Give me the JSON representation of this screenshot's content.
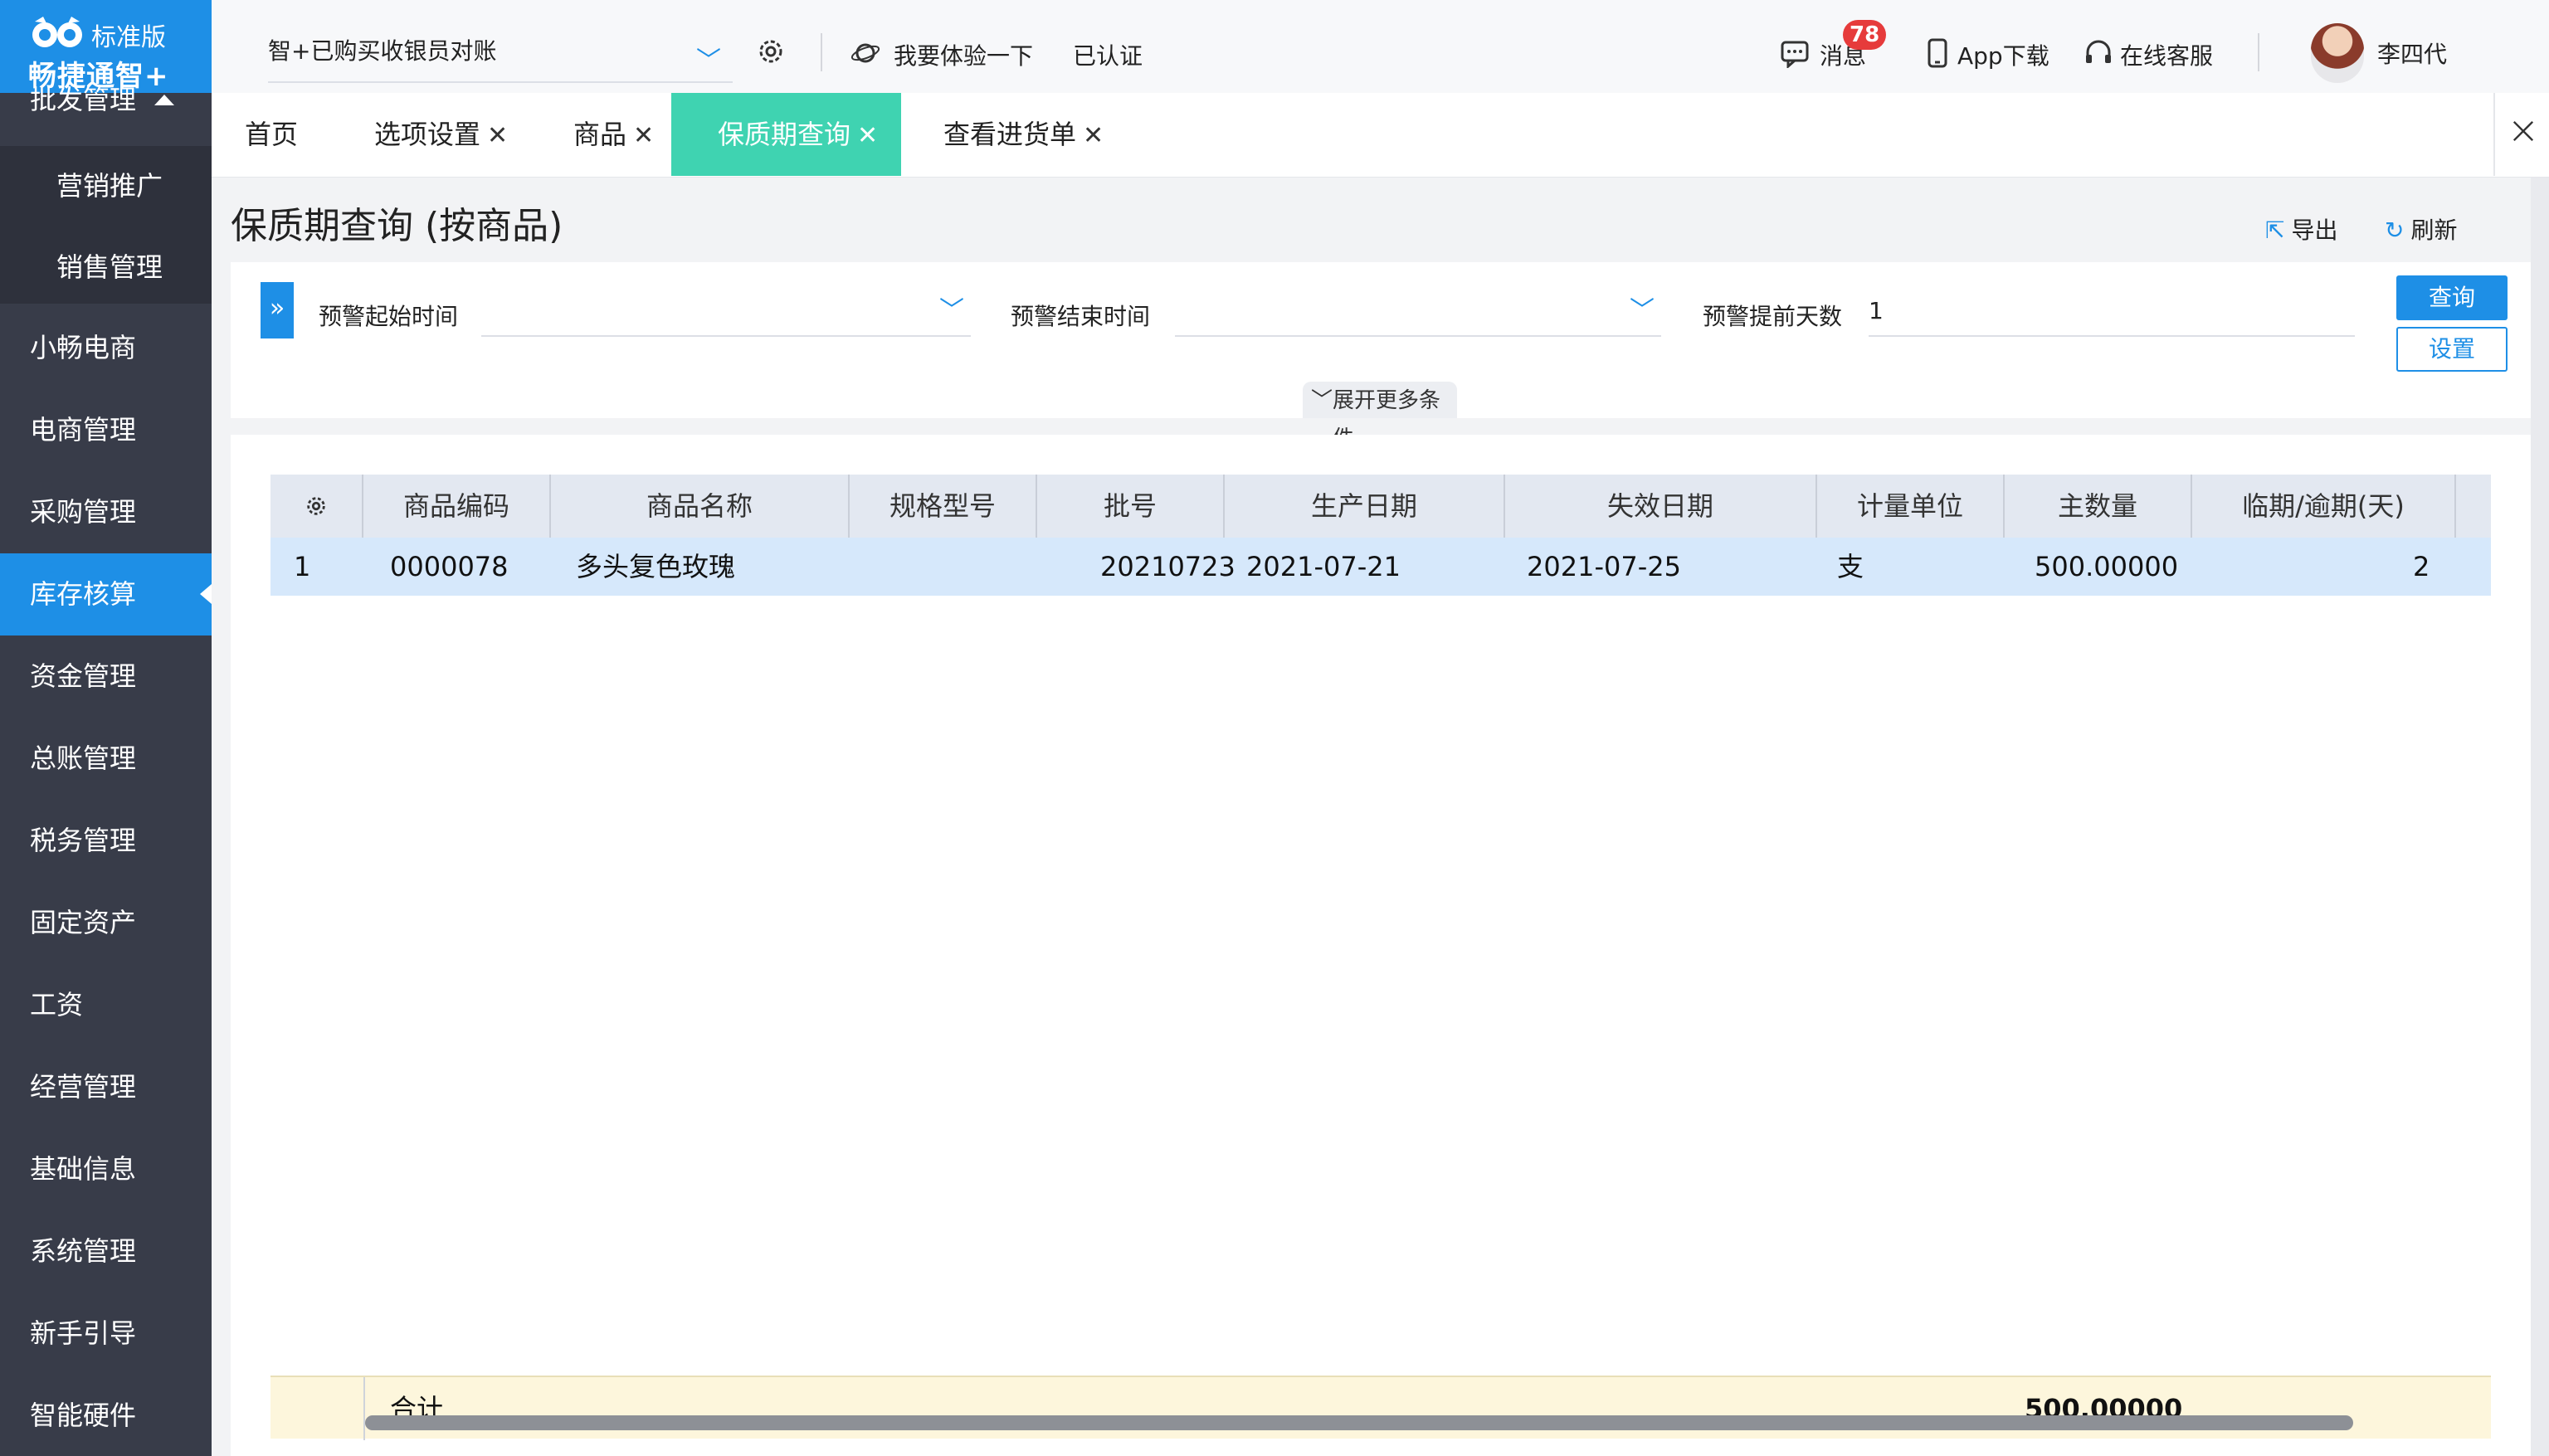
{
  "app": {
    "edition": "标准版",
    "brand": "畅捷通智+"
  },
  "sidebar": {
    "group_header": "批发管理",
    "subitems": [
      {
        "label": "营销推广"
      },
      {
        "label": "销售管理"
      }
    ],
    "items": [
      {
        "label": "小畅电商"
      },
      {
        "label": "电商管理"
      },
      {
        "label": "采购管理"
      },
      {
        "label": "库存核算",
        "active": true
      },
      {
        "label": "资金管理"
      },
      {
        "label": "总账管理"
      },
      {
        "label": "税务管理"
      },
      {
        "label": "固定资产"
      },
      {
        "label": "工资"
      },
      {
        "label": "经营管理"
      },
      {
        "label": "基础信息"
      },
      {
        "label": "系统管理"
      },
      {
        "label": "新手引导"
      },
      {
        "label": "智能硬件"
      }
    ]
  },
  "topbar": {
    "account": "智+已购买收银员对账",
    "try_label": "我要体验一下",
    "certified": "已认证",
    "messages_label": "消息",
    "messages_count": "78",
    "app_download": "App下载",
    "support": "在线客服",
    "username": "李四代"
  },
  "tabs": [
    {
      "label": "首页",
      "closable": false
    },
    {
      "label": "选项设置",
      "closable": true
    },
    {
      "label": "商品",
      "closable": true
    },
    {
      "label": "保质期查询",
      "closable": true,
      "active": true
    },
    {
      "label": "查看进货单",
      "closable": true
    }
  ],
  "page": {
    "title": "保质期查询 (按商品)",
    "export_label": "导出",
    "refresh_label": "刷新"
  },
  "filters": {
    "start_label": "预警起始时间",
    "start_value": "",
    "end_label": "预警结束时间",
    "end_value": "",
    "days_label": "预警提前天数",
    "days_value": "1",
    "query_label": "查询",
    "settings_label": "设置",
    "more_label": "展开更多条件"
  },
  "table": {
    "columns": [
      "商品编码",
      "商品名称",
      "规格型号",
      "批号",
      "生产日期",
      "失效日期",
      "计量单位",
      "主数量",
      "临期/逾期(天)"
    ],
    "rows": [
      {
        "index": "1",
        "code": "0000078",
        "name": "多头复色玫瑰",
        "spec": "",
        "batch": "20210723",
        "produced": "2021-07-21",
        "expires": "2021-07-25",
        "unit": "支",
        "qty": "500.00000",
        "days": "2"
      }
    ],
    "footer": {
      "label": "合计",
      "qty_total": "500.00000"
    }
  },
  "colors": {
    "primary": "#1e8fe6",
    "active_tab": "#3fd3b1",
    "sidebar_bg": "#383c49",
    "selected_row": "#d6e8fb",
    "footer_row": "#fdf6dc",
    "badge": "#e63b3b"
  }
}
